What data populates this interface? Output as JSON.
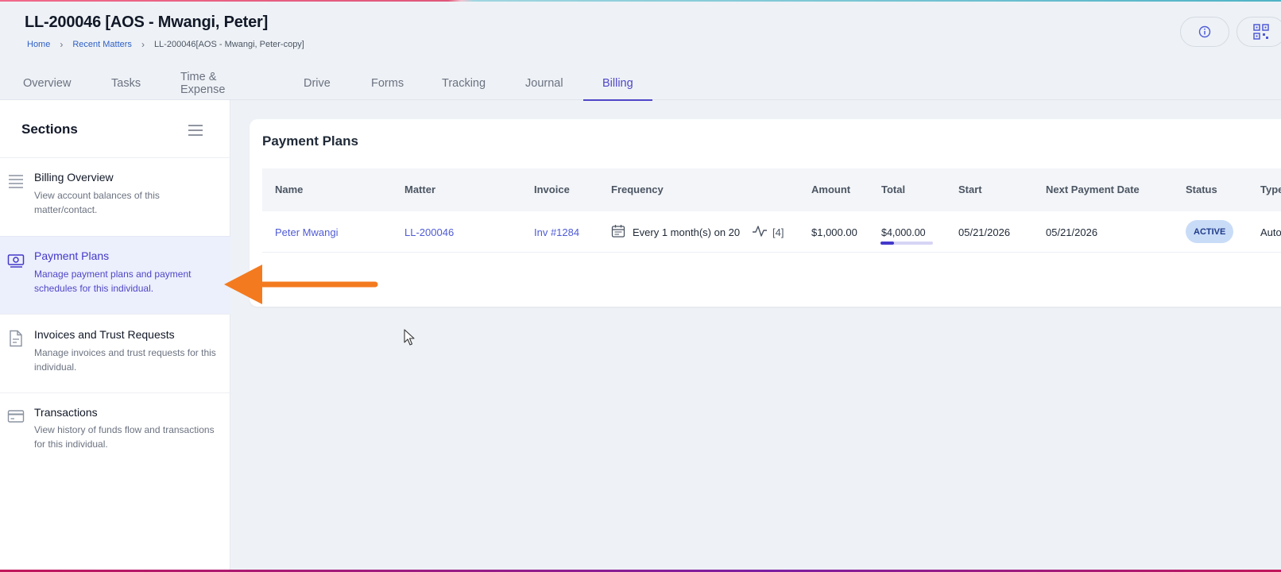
{
  "header": {
    "title": "LL-200046 [AOS - Mwangi, Peter]",
    "breadcrumb": {
      "home": "Home",
      "recent": "Recent Matters",
      "current": "LL-200046[AOS - Mwangi, Peter-copy]",
      "separator": "›"
    }
  },
  "tabs": [
    "Overview",
    "Tasks",
    "Time & Expense",
    "Drive",
    "Forms",
    "Tracking",
    "Journal",
    "Billing"
  ],
  "active_tab": "Billing",
  "sidebar": {
    "title": "Sections",
    "items": [
      {
        "label": "Billing Overview",
        "description": "View account balances of this matter/contact.",
        "icon": "list-icon"
      },
      {
        "label": "Payment Plans",
        "description": "Manage payment plans and payment schedules for this individual.",
        "icon": "money-icon"
      },
      {
        "label": "Invoices and Trust Requests",
        "description": "Manage invoices and trust requests for this individual.",
        "icon": "document-icon"
      },
      {
        "label": "Transactions",
        "description": "View history of funds flow and transactions for this individual.",
        "icon": "credit-card-icon"
      }
    ],
    "active_item": "Payment Plans"
  },
  "main": {
    "title": "Payment Plans",
    "columns": [
      "Name",
      "Matter",
      "Invoice",
      "Frequency",
      "Amount",
      "Total",
      "Start",
      "Next Payment Date",
      "Status",
      "Type"
    ],
    "rows": [
      {
        "name": "Peter Mwangi",
        "matter": "LL-200046",
        "invoice": "Inv #1284",
        "frequency": "Every 1 month(s) on 20",
        "count": "[4]",
        "amount": "$1,000.00",
        "total": "$4,000.00",
        "total_progress": 0.25,
        "start": "05/21/2026",
        "next_payment": "05/21/2026",
        "status": "ACTIVE",
        "type": "Auto"
      }
    ]
  },
  "colors": {
    "accent": "#4f46c8",
    "link": "#4f5bd5",
    "arrow": "#f47a1f",
    "active_bg": "#eceffc",
    "badge_bg": "#c9dcf7"
  }
}
